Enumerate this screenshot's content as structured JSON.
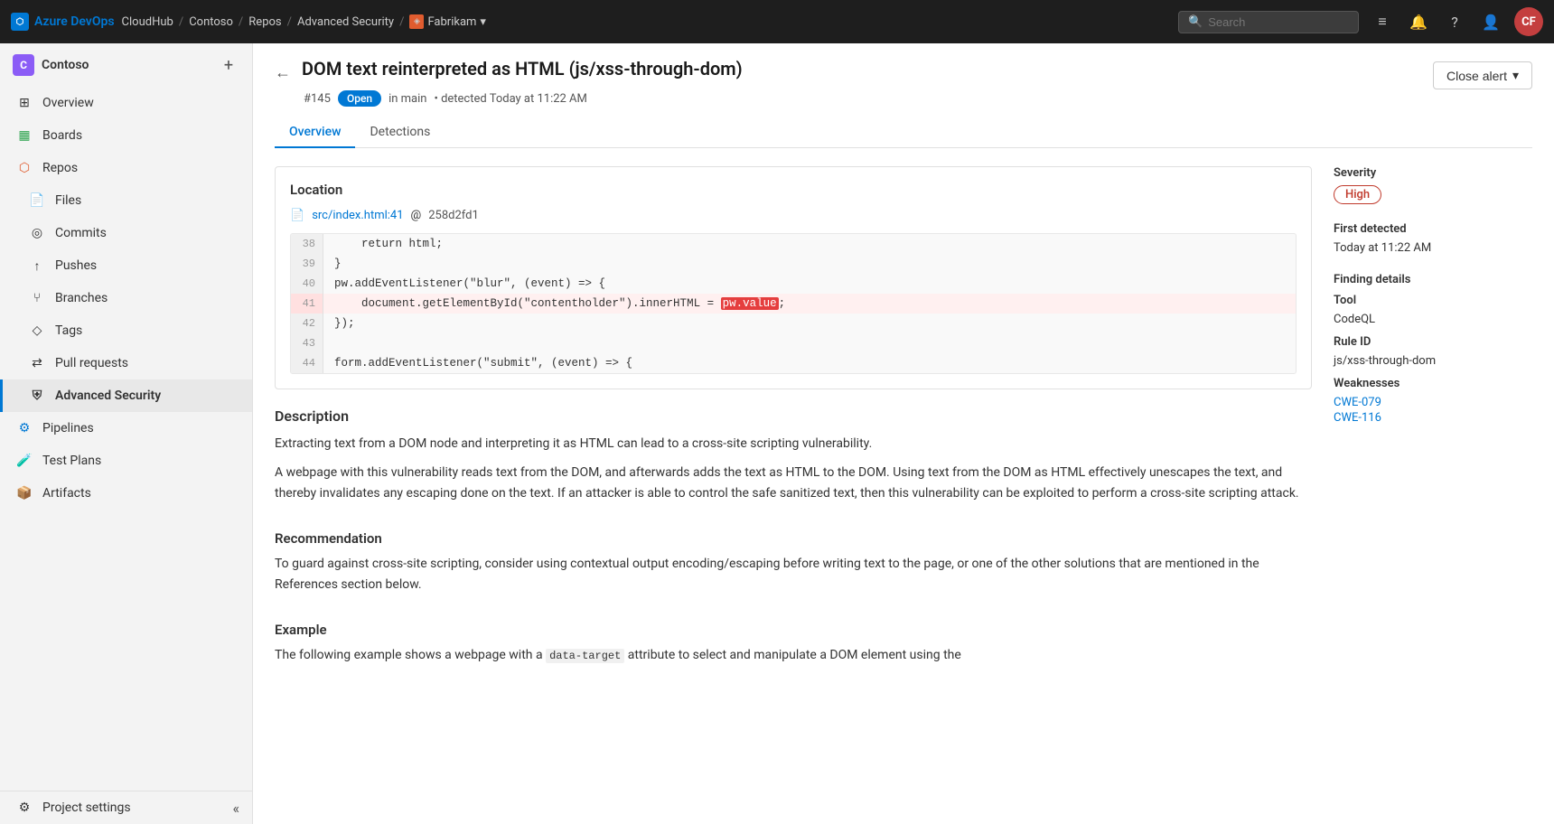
{
  "topnav": {
    "logo_text": "Azure DevOps",
    "org": "CloudHub",
    "sep1": "/",
    "project": "Contoso",
    "sep2": "/",
    "section": "Repos",
    "sep3": "/",
    "subsection": "Advanced Security",
    "sep4": "/",
    "repo": "Fabrikam",
    "repo_dropdown": "▾",
    "search_placeholder": "Search",
    "search_label": "Search",
    "avatar_initials": "CF"
  },
  "sidebar": {
    "org_name": "Contoso",
    "org_initial": "C",
    "add_icon": "+",
    "items": [
      {
        "label": "Overview",
        "icon": "⊞",
        "active": false
      },
      {
        "label": "Boards",
        "icon": "▦",
        "active": false
      },
      {
        "label": "Repos",
        "icon": "⬡",
        "active": false
      },
      {
        "label": "Files",
        "icon": "📄",
        "active": false
      },
      {
        "label": "Commits",
        "icon": "◎",
        "active": false
      },
      {
        "label": "Pushes",
        "icon": "↑",
        "active": false
      },
      {
        "label": "Branches",
        "icon": "⑂",
        "active": false
      },
      {
        "label": "Tags",
        "icon": "◇",
        "active": false
      },
      {
        "label": "Pull requests",
        "icon": "⇄",
        "active": false
      },
      {
        "label": "Advanced Security",
        "icon": "⛨",
        "active": true
      }
    ],
    "bottom_items": [
      {
        "label": "Pipelines",
        "icon": "⚙",
        "active": false
      },
      {
        "label": "Test Plans",
        "icon": "🧪",
        "active": false
      },
      {
        "label": "Artifacts",
        "icon": "📦",
        "active": false
      }
    ],
    "footer_items": [
      {
        "label": "Project settings",
        "icon": "⚙",
        "active": false
      }
    ]
  },
  "alert": {
    "back_label": "←",
    "title": "DOM text reinterpreted as HTML (js/xss-through-dom)",
    "number": "#145",
    "status": "Open",
    "branch": "in main",
    "detected": "• detected Today at 11:22 AM",
    "close_button": "Close alert",
    "close_chevron": "▾",
    "tabs": [
      {
        "label": "Overview",
        "active": true
      },
      {
        "label": "Detections",
        "active": false
      }
    ]
  },
  "location": {
    "section_title": "Location",
    "file_path": "src/index.html:41",
    "at": "@",
    "commit": "258d2fd1",
    "code_lines": [
      {
        "num": "38",
        "code": "    return html;",
        "highlighted": false
      },
      {
        "num": "39",
        "code": "}",
        "highlighted": false
      },
      {
        "num": "40",
        "code": "pw.addEventListener(\"blur\", (event) => {",
        "highlighted": false
      },
      {
        "num": "41",
        "code": "    document.getElementById(\"contentholder\").innerHTML = ",
        "highlighted": true,
        "token": "pw.value",
        "after": ";"
      },
      {
        "num": "42",
        "code": "});",
        "highlighted": false
      },
      {
        "num": "43",
        "code": "",
        "highlighted": false
      },
      {
        "num": "44",
        "code": "form.addEventListener(\"submit\", (event) => {",
        "highlighted": false
      }
    ]
  },
  "description": {
    "title": "Description",
    "paragraphs": [
      "Extracting text from a DOM node and interpreting it as HTML can lead to a cross-site scripting vulnerability.",
      "A webpage with this vulnerability reads text from the DOM, and afterwards adds the text as HTML to the DOM. Using text from the DOM as HTML effectively unescapes the text, and thereby invalidates any escaping done on the text. If an attacker is able to control the safe sanitized text, then this vulnerability can be exploited to perform a cross-site scripting attack."
    ]
  },
  "recommendation": {
    "title": "Recommendation",
    "text": "To guard against cross-site scripting, consider using contextual output encoding/escaping before writing text to the page, or one of the other solutions that are mentioned in the References section below."
  },
  "example": {
    "title": "Example",
    "text": "The following example shows a webpage with a data-target attribute to select and manipulate a DOM element using the"
  },
  "side_panel": {
    "severity_label": "Severity",
    "severity_value": "High",
    "first_detected_label": "First detected",
    "first_detected_value": "Today at 11:22 AM",
    "finding_details_label": "Finding details",
    "tool_label": "Tool",
    "tool_value": "CodeQL",
    "rule_id_label": "Rule ID",
    "rule_id_value": "js/xss-through-dom",
    "weaknesses_label": "Weaknesses",
    "weaknesses": [
      {
        "label": "CWE-079",
        "href": "#"
      },
      {
        "label": "CWE-116",
        "href": "#"
      }
    ]
  }
}
